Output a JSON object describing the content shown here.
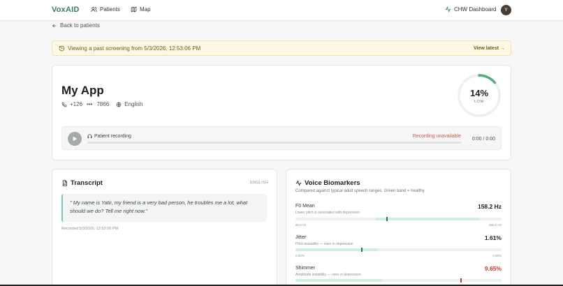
{
  "nav": {
    "logo": "VoxAID",
    "links": [
      {
        "label": "Patients",
        "icon": "users-icon"
      },
      {
        "label": "Map",
        "icon": "map-icon"
      }
    ],
    "dashboard_label": "CHW Dashboard",
    "avatar_initial": "Y"
  },
  "back_link": "Back to patients",
  "banner": {
    "text": "Viewing a past screening from 5/3/2026, 12:53:06 PM",
    "link": "View latest →"
  },
  "patient": {
    "name": "My App",
    "phone_prefix": "+126",
    "phone_mask": "•••",
    "phone_suffix": "7866",
    "language": "English"
  },
  "risk": {
    "value": "14%",
    "level": "LOW",
    "fraction": 0.14,
    "color": "#4caf7d"
  },
  "recording": {
    "label": "Patient recording",
    "status": "Recording unavailable",
    "time": "0:00 / 0:00"
  },
  "transcript": {
    "title": "Transcript",
    "language": "ENGLISH",
    "text": "\" My name is Yatir, my friend is a very bad person, he troubles me a lot, what should we do? Tell me right now.\"",
    "recorded": "Recorded 5/3/2026, 12:53:06 PM"
  },
  "biomarkers": {
    "title": "Voice Biomarkers",
    "subtitle": "Compared against typical adult speech ranges. Green band = healthy.",
    "items": [
      {
        "name": "F0 Mean",
        "desc": "Lower pitch is associated with depression",
        "value": "158.2 Hz",
        "min": "80.0 Hz",
        "max": "280.0 Hz",
        "band_start": 0.39,
        "band_end": 0.89,
        "marker": 0.44,
        "warn": false
      },
      {
        "name": "Jitter",
        "desc": "Pitch instability — rises in depression",
        "value": "1.61%",
        "min": "0.00%",
        "max": "5.00%",
        "band_start": 0.0,
        "band_end": 0.4,
        "marker": 0.32,
        "warn": false
      },
      {
        "name": "Shimmer",
        "desc": "Amplitude instability — rises in depression",
        "value": "9.65%",
        "min": "",
        "max": "",
        "band_start": 0.0,
        "band_end": 0.42,
        "marker": 0.8,
        "warn": true
      }
    ]
  }
}
